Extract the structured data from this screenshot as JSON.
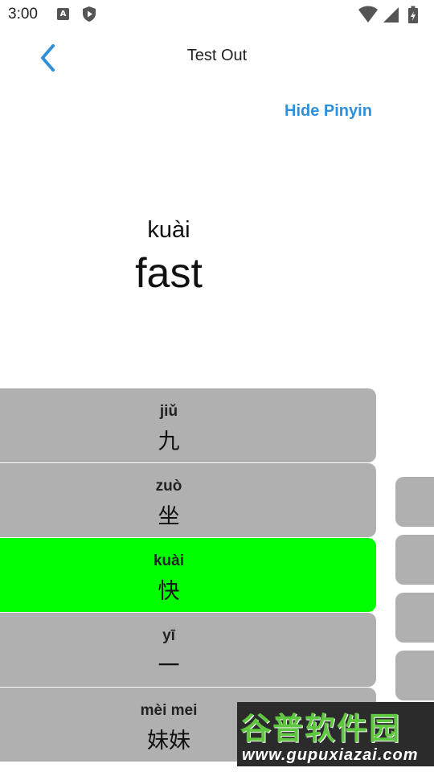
{
  "status_bar": {
    "time": "3:00",
    "icons": [
      "a-notification-icon",
      "play-protect-icon",
      "wifi-icon",
      "signal-icon",
      "battery-charging-icon"
    ],
    "icon_a_letter": "A"
  },
  "header": {
    "title": "Test Out",
    "back_icon": "chevron-left-icon"
  },
  "toggle_pinyin_label": "Hide Pinyin",
  "prompt": {
    "pinyin": "kuài",
    "word": "fast"
  },
  "options": [
    {
      "pinyin": "jiǔ",
      "hanzi": "九",
      "selected": false
    },
    {
      "pinyin": "zuò",
      "hanzi": "坐",
      "selected": false
    },
    {
      "pinyin": "kuài",
      "hanzi": "快",
      "selected": true
    },
    {
      "pinyin": "yī",
      "hanzi": "一",
      "selected": false
    },
    {
      "pinyin": "mèi mei",
      "hanzi": "妹妹",
      "selected": false
    }
  ],
  "colors": {
    "accent": "#2f8fd8",
    "option_default": "#b0b0b0",
    "option_selected": "#00ff00"
  },
  "watermark": {
    "title": "谷普软件园",
    "url": "www.gupuxiazai.com"
  }
}
